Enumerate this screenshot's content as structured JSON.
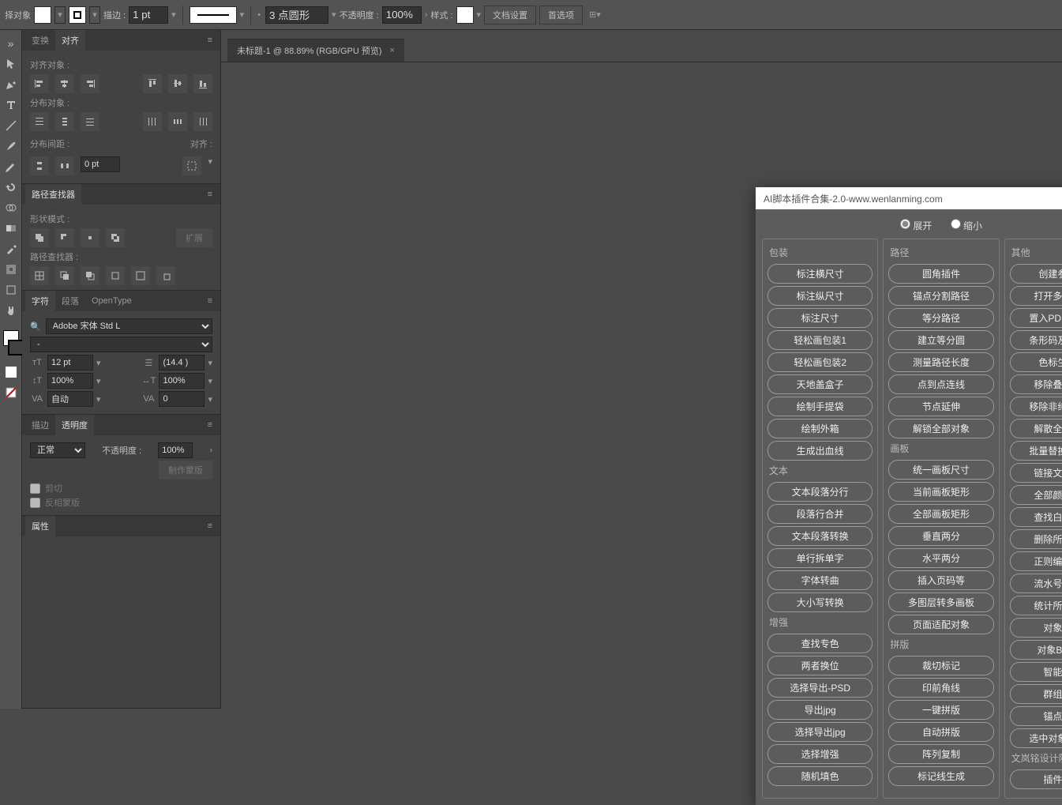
{
  "topbar": {
    "select_label": "择对象",
    "stroke_label": "描边 :",
    "stroke_value": "1 pt",
    "dash_value": "3 点圆形",
    "opacity_label": "不透明度 :",
    "opacity_value": "100%",
    "style_label": "样式 :",
    "doc_setup": "文档设置",
    "preferences": "首选项"
  },
  "document": {
    "tab_title": "未标题-1 @ 88.89% (RGB/GPU 预览)"
  },
  "panels": {
    "transform_tab": "变换",
    "align_tab": "对齐",
    "align_objects": "对齐对象 :",
    "distribute_objects": "分布对象 :",
    "distribute_spacing": "分布间距 :",
    "align_to": "对齐 :",
    "spacing_value": "0 pt",
    "pathfinder_title": "路径查找器",
    "shape_mode": "形状模式 :",
    "pathfinder_label": "路径查找器 :",
    "expand": "扩展",
    "char_tab": "字符",
    "para_tab": "段落",
    "opentype_tab": "OpenType",
    "font_name": "Adobe 宋体 Std L",
    "font_style": "-",
    "font_size": "12 pt",
    "leading": "(14.4 )",
    "h_scale": "100%",
    "v_scale": "100%",
    "kerning": "自动",
    "tracking": "0",
    "stroke_tab": "描边",
    "transparency_tab": "透明度",
    "blend_mode": "正常",
    "opacity_label2": "不透明度 :",
    "opacity_value2": "100%",
    "make_mask": "制作蒙版",
    "clip": "剪切",
    "invert_mask": "反相蒙版",
    "properties_title": "属性"
  },
  "dialog": {
    "title": "AI脚本插件合集-2.0-www.wenlanming.com",
    "expand": "展开",
    "collapse": "缩小",
    "columns": [
      {
        "groups": [
          {
            "title": "包装",
            "items": [
              "标注横尺寸",
              "标注纵尺寸",
              "标注尺寸",
              "轻松画包装1",
              "轻松画包装2",
              "天地盖盒子",
              "绘制手提袋",
              "绘制外箱",
              "生成出血线"
            ]
          },
          {
            "title": "文本",
            "items": [
              "文本段落分行",
              "段落行合并",
              "文本段落转换",
              "单行拆单字",
              "字体转曲",
              "大小写转换"
            ]
          },
          {
            "title": "增强",
            "items": [
              "查找专色",
              "两者换位",
              "选择导出-PSD",
              "导出jpg",
              "选择导出jpg",
              "选择增强",
              "随机填色"
            ]
          }
        ]
      },
      {
        "groups": [
          {
            "title": "路径",
            "items": [
              "圆角插件",
              "锚点分割路径",
              "等分路径",
              "建立等分圆",
              "测量路径长度",
              "点到点连线",
              "节点延伸",
              "解锁全部对象"
            ]
          },
          {
            "title": "画板",
            "items": [
              "统一画板尺寸",
              "当前画板矩形",
              "全部画板矩形",
              "垂直两分",
              "水平两分",
              "插入页码等",
              "多图层转多画板",
              "页面适配对象"
            ]
          },
          {
            "title": "拼版",
            "items": [
              "裁切标记",
              "印前角线",
              "一键拼版",
              "自动拼版",
              "阵列复制",
              "标记线生成"
            ]
          }
        ]
      },
      {
        "groups": [
          {
            "title": "其他",
            "items": [
              "创建参考线",
              "打开多页PDF",
              "置入PDF多页面",
              "条形码及二维码",
              "色标生成器",
              "移除叠印属性",
              "移除非纯黑叠印",
              "解散全部群组",
              "批量替换链接图",
              "链接文件打包",
              "全部颜色转黑",
              "查找白色叠印",
              "删除所有蒙版",
              "正则编辑文本",
              "流水号生成器",
              "统计所选对象",
              "对象替换",
              "对象B替换A",
              "智能群组",
              "群组拼版",
              "锚点选择",
              "选中对象去重线"
            ]
          },
          {
            "title": "文岚铭设计院",
            "items": [
              "插件说明"
            ]
          }
        ]
      }
    ]
  }
}
